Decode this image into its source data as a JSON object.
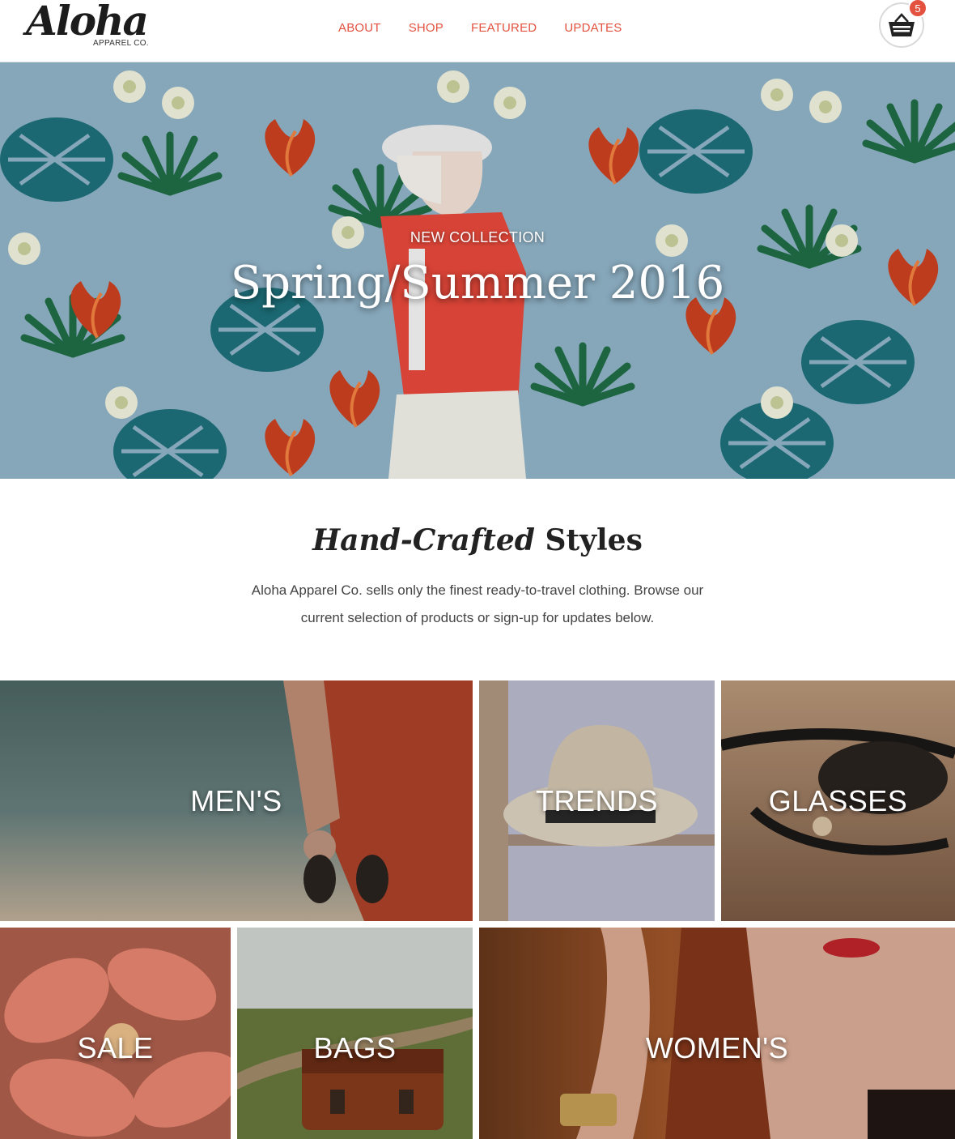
{
  "brand": {
    "logo_text": "Aloha",
    "logo_subtext": "APPAREL CO."
  },
  "nav": {
    "items": [
      {
        "label": "ABOUT"
      },
      {
        "label": "SHOP"
      },
      {
        "label": "FEATURED"
      },
      {
        "label": "UPDATES"
      }
    ]
  },
  "cart": {
    "count": "5",
    "icon": "basket-icon"
  },
  "hero": {
    "eyebrow": "NEW COLLECTION",
    "title": "Spring/Summer 2016"
  },
  "intro": {
    "title_italic": "Hand-Crafted",
    "title_bold": "Styles",
    "text": "Aloha Apparel Co. sells only the finest ready-to-travel clothing. Browse our current selection of products or sign-up for updates below."
  },
  "categories": [
    {
      "label": "MEN'S"
    },
    {
      "label": "TRENDS"
    },
    {
      "label": "GLASSES"
    },
    {
      "label": "SALE"
    },
    {
      "label": "BAGS"
    },
    {
      "label": "WOMEN'S"
    }
  ],
  "colors": {
    "accent": "#e3513f",
    "hero_bg": "#8fb2c6"
  }
}
